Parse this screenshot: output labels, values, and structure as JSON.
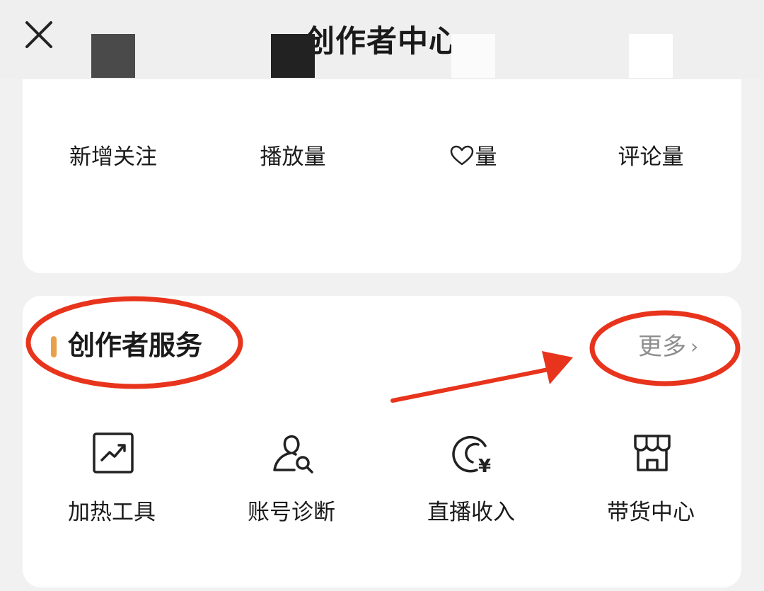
{
  "header": {
    "title": "创作者中心",
    "close_icon": "close-icon"
  },
  "stats": [
    {
      "label": "新增关注",
      "value_color": "#4a4a4a"
    },
    {
      "label": "播放量",
      "value_color": "#222222"
    },
    {
      "label": "量",
      "prefix_icon": "heart-icon",
      "value_color": "#fbfbfb"
    },
    {
      "label": "评论量",
      "value_color": "#ffffff"
    }
  ],
  "section": {
    "title": "创作者服务",
    "accent_color": "#e8a04a",
    "more_label": "更多",
    "more_icon": "chevron-right-icon"
  },
  "services": [
    {
      "label": "加热工具",
      "icon": "trend-chart-icon"
    },
    {
      "label": "账号诊断",
      "icon": "user-search-icon"
    },
    {
      "label": "直播收入",
      "icon": "live-income-icon"
    },
    {
      "label": "带货中心",
      "icon": "store-icon"
    }
  ],
  "annotations": {
    "color": "#e8341c",
    "shapes": [
      "ellipse-section-title",
      "ellipse-more",
      "arrow-to-more"
    ]
  }
}
